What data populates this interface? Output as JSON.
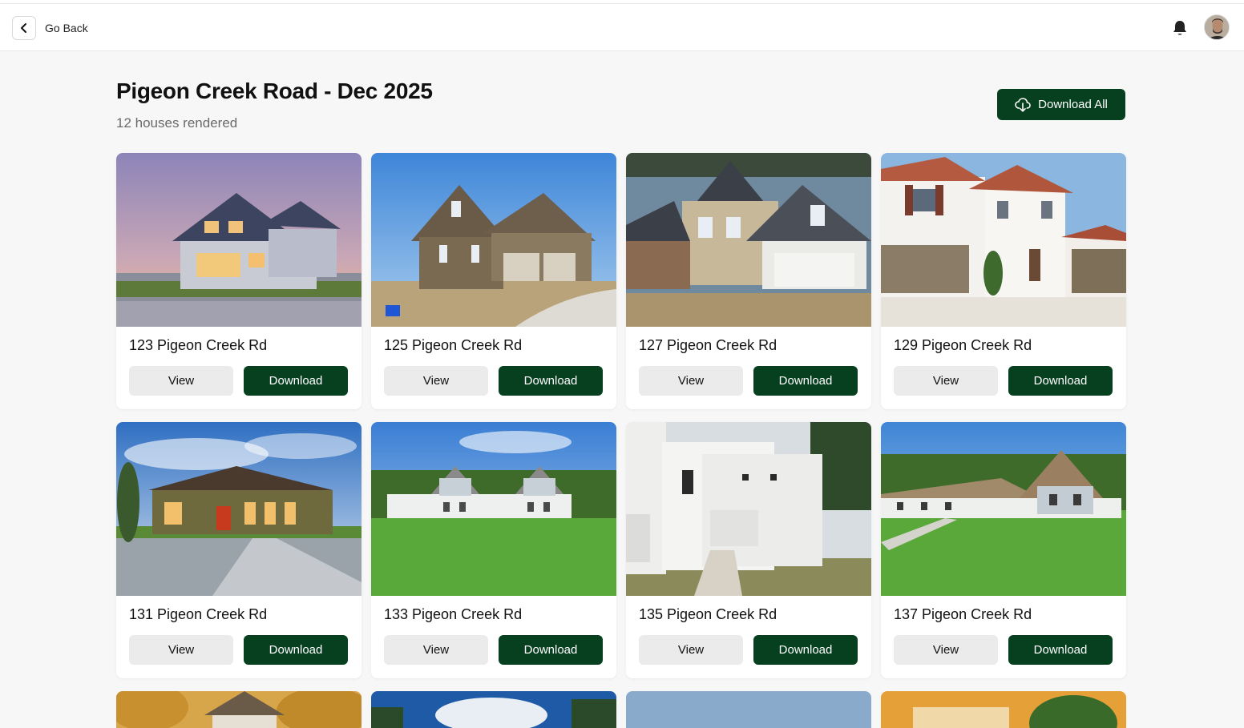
{
  "nav": {
    "back_label": "Go Back"
  },
  "header": {
    "title": "Pigeon Creek Road - Dec 2025",
    "subtitle": "12 houses rendered",
    "download_all_label": "Download All"
  },
  "houses": [
    {
      "address": "123 Pigeon Creek Rd",
      "view_label": "View",
      "download_label": "Download"
    },
    {
      "address": "125 Pigeon Creek Rd",
      "view_label": "View",
      "download_label": "Download"
    },
    {
      "address": "127 Pigeon Creek Rd",
      "view_label": "View",
      "download_label": "Download"
    },
    {
      "address": "129 Pigeon Creek Rd",
      "view_label": "View",
      "download_label": "Download"
    },
    {
      "address": "131 Pigeon Creek Rd",
      "view_label": "View",
      "download_label": "Download"
    },
    {
      "address": "133 Pigeon Creek Rd",
      "view_label": "View",
      "download_label": "Download"
    },
    {
      "address": "135 Pigeon Creek Rd",
      "view_label": "View",
      "download_label": "Download"
    },
    {
      "address": "137 Pigeon Creek Rd",
      "view_label": "View",
      "download_label": "Download"
    }
  ],
  "colors": {
    "primary": "#07401f",
    "secondary_button": "#ebebeb",
    "page_background": "#f7f7f7"
  },
  "icons": {
    "back": "chevron-left-icon",
    "notifications": "bell-icon",
    "download_all": "cloud-download-icon"
  }
}
